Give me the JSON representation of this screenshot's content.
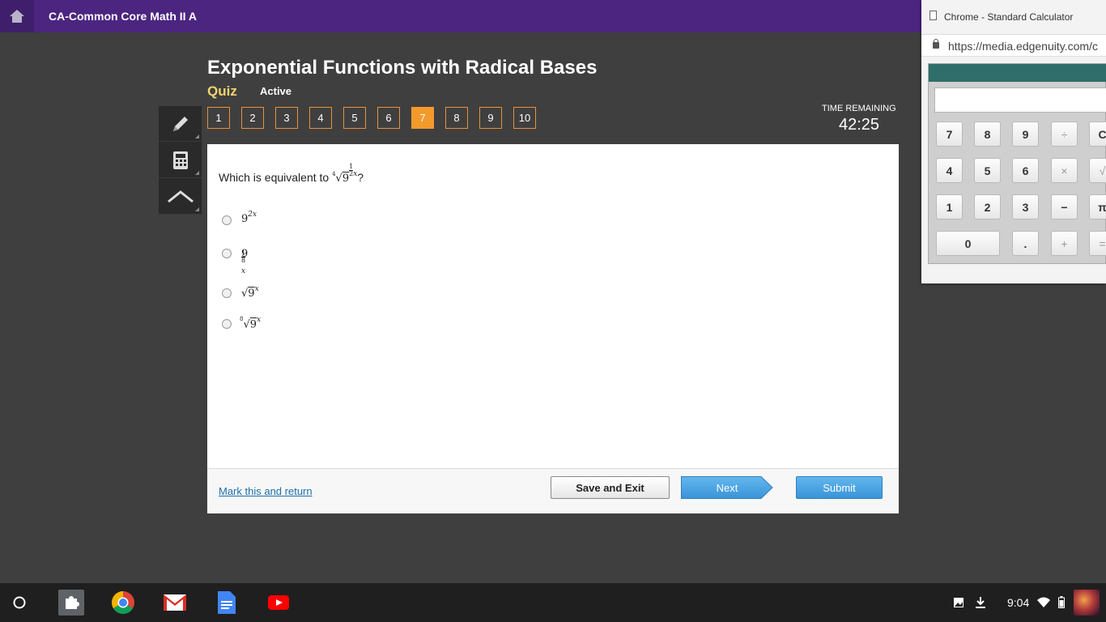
{
  "topbar": {
    "course_title": "CA-Common Core Math II A"
  },
  "lesson": {
    "title": "Exponential Functions with Radical Bases",
    "mode": "Quiz",
    "status": "Active"
  },
  "question_nav": {
    "numbers": [
      "1",
      "2",
      "3",
      "4",
      "5",
      "6",
      "7",
      "8",
      "9",
      "10"
    ],
    "active": "7"
  },
  "timer": {
    "label": "TIME REMAINING",
    "value": "42:25"
  },
  "question": {
    "prompt_prefix": "Which is equivalent to",
    "prompt_suffix": "?",
    "expr_index": "4",
    "expr_base": "9",
    "expr_frac_num": "1",
    "expr_frac_den": "2",
    "expr_var": "x"
  },
  "answers": [
    {
      "base": "9",
      "exp": "2x"
    },
    {
      "base": "9",
      "frac_num": "1",
      "frac_den": "8",
      "var": "x"
    },
    {
      "radical": "√",
      "base": "9",
      "exp": "x"
    },
    {
      "index": "8",
      "radical": "√",
      "base": "9",
      "exp": "x"
    }
  ],
  "footer": {
    "mark_link": "Mark this and return",
    "save": "Save and Exit",
    "next": "Next",
    "submit": "Submit"
  },
  "calculator": {
    "window_title": "Chrome - Standard Calculator",
    "url": "https://media.edgenuity.com/c",
    "keys_row1": [
      "7",
      "8",
      "9",
      "÷",
      "C"
    ],
    "keys_row2": [
      "4",
      "5",
      "6",
      "×",
      "√"
    ],
    "keys_row3": [
      "1",
      "2",
      "3",
      "−",
      "π"
    ],
    "keys_row4": [
      "0",
      ".",
      "+",
      "="
    ]
  },
  "taskbar": {
    "time": "9:04"
  },
  "colors": {
    "topbar": "#4b2580",
    "accent": "#f39a2c",
    "quiz_label": "#f3d46f",
    "link": "#1f6fa8"
  }
}
